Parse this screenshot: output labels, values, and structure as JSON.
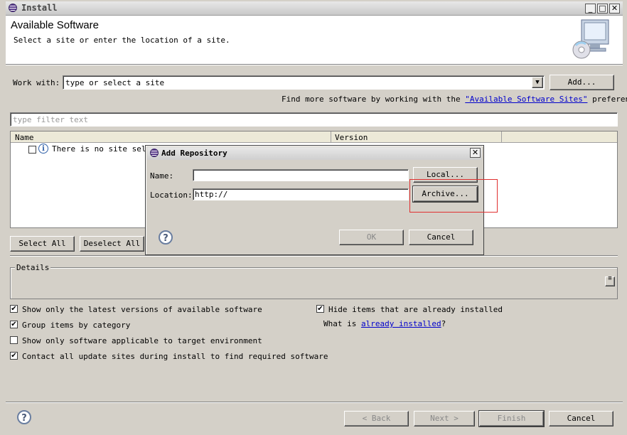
{
  "window": {
    "title": "Install"
  },
  "header": {
    "title": "Available Software",
    "subtitle": "Select a site or enter the location of a site."
  },
  "work_with": {
    "label": "Work with:",
    "value": "type or select a site",
    "add_button": "Add..."
  },
  "find_more": {
    "prefix": "Find more software by working with the ",
    "link": "\"Available Software Sites\"",
    "suffix": " preferences."
  },
  "filter": {
    "placeholder": "type filter text"
  },
  "table": {
    "columns": [
      "Name",
      "Version"
    ],
    "row_text": "There is no site selec"
  },
  "buttons": {
    "select_all": "Select All",
    "deselect_all": "Deselect All"
  },
  "details": {
    "label": "Details"
  },
  "options": {
    "latest": {
      "label": "Show only the latest versions of available software",
      "checked": true
    },
    "group": {
      "label": "Group items by category",
      "checked": true
    },
    "target": {
      "label": "Show only software applicable to target environment",
      "checked": false
    },
    "contact": {
      "label": "Contact all update sites during install to find required software",
      "checked": true
    },
    "hide": {
      "label": "Hide items that are already installed",
      "checked": true
    },
    "what_is_prefix": "What is ",
    "what_is_link": "already installed",
    "what_is_suffix": "?"
  },
  "footer": {
    "back": "< Back",
    "next": "Next >",
    "finish": "Finish",
    "cancel": "Cancel"
  },
  "dialog": {
    "title": "Add Repository",
    "name_label": "Name:",
    "name_value": "",
    "location_label": "Location:",
    "location_value": "http://",
    "local_button": "Local...",
    "archive_button": "Archive...",
    "ok_button": "OK",
    "cancel_button": "Cancel"
  },
  "colors": {
    "highlight": "#e03030",
    "link": "#0000cc"
  }
}
